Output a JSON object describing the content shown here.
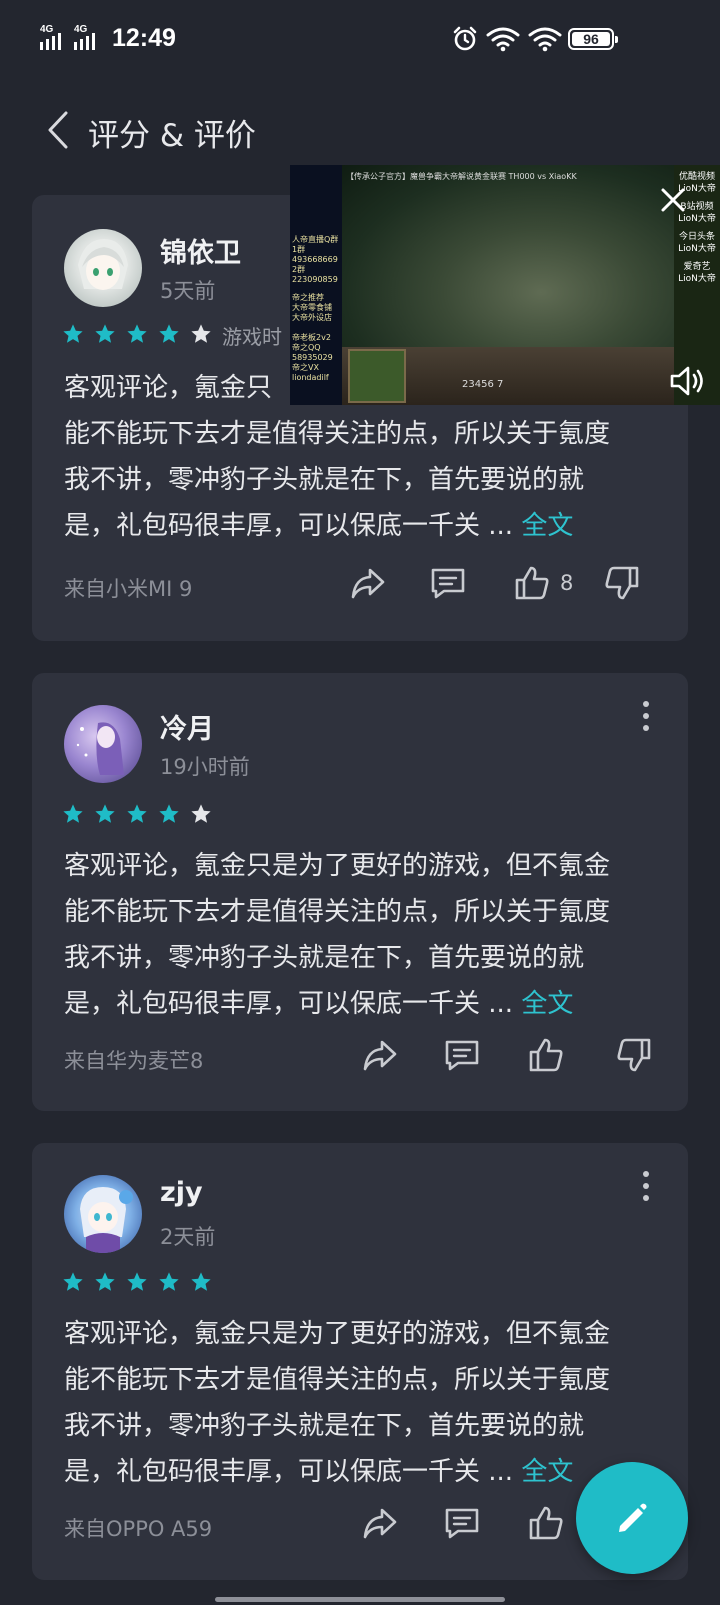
{
  "status_bar": {
    "time": "12:49",
    "network_1": "4G",
    "network_2": "4G",
    "battery": "96"
  },
  "header": {
    "title": "评分 & 评价"
  },
  "pip_video": {
    "title": "【传承公子官方】魔兽争霸大帝解说黄金联赛 TH000 vs XiaoKK",
    "left_text": [
      "人帝直播Q群",
      "1群493668669",
      "2群223090859",
      "帝之推荐",
      "大帝零食铺",
      "大帝外设店",
      "帝老板2v2",
      "帝之QQ",
      "58935029",
      "帝之VX",
      "liondadilf"
    ],
    "right_text": [
      "优酷视频",
      "LioN大帝",
      "B站视频",
      "LioN大帝",
      "今日头条",
      "LioN大帝",
      "爱奇艺",
      "LioN大帝"
    ],
    "hud_text": "23456 7"
  },
  "reviews": [
    {
      "username": "锦依卫",
      "time": "5天前",
      "rating": 4,
      "playtime": "游戏时",
      "lines": [
        "客观评论，氪金只",
        "能不能玩下去才是值得关注的点，所以关于氪度",
        "我不讲，零冲豹子头就是在下，首先要说的就",
        "是，礼包码很丰厚，可以保底一千关 ..."
      ],
      "full_link": "全文",
      "device": "来自小米MI 9",
      "likes": "8"
    },
    {
      "username": "冷月",
      "time": "19小时前",
      "rating": 4,
      "lines": [
        "客观评论，氪金只是为了更好的游戏，但不氪金",
        "能不能玩下去才是值得关注的点，所以关于氪度",
        "我不讲，零冲豹子头就是在下，首先要说的就",
        "是，礼包码很丰厚，可以保底一千关 ..."
      ],
      "full_link": "全文",
      "device": "来自华为麦芒8",
      "likes": ""
    },
    {
      "username": "zjy",
      "time": "2天前",
      "rating": 5,
      "lines": [
        "客观评论，氪金只是为了更好的游戏，但不氪金",
        "能不能玩下去才是值得关注的点，所以关于氪度",
        "我不讲，零冲豹子头就是在下，首先要说的就",
        "是，礼包码很丰厚，可以保底一千关 ..."
      ],
      "full_link": "全文",
      "device": "来自OPPO A59",
      "likes": ""
    }
  ],
  "colors": {
    "background": "#23262f",
    "card": "#2f323d",
    "accent": "#2ec3cf",
    "star_filled": "#1fbcc7",
    "star_empty": "#e6e7ea"
  },
  "icons": {
    "back": "chevron-left-icon",
    "share": "share-icon",
    "comment": "comment-icon",
    "like": "thumbs-up-icon",
    "dislike": "thumbs-down-icon",
    "fab": "pencil-icon"
  }
}
